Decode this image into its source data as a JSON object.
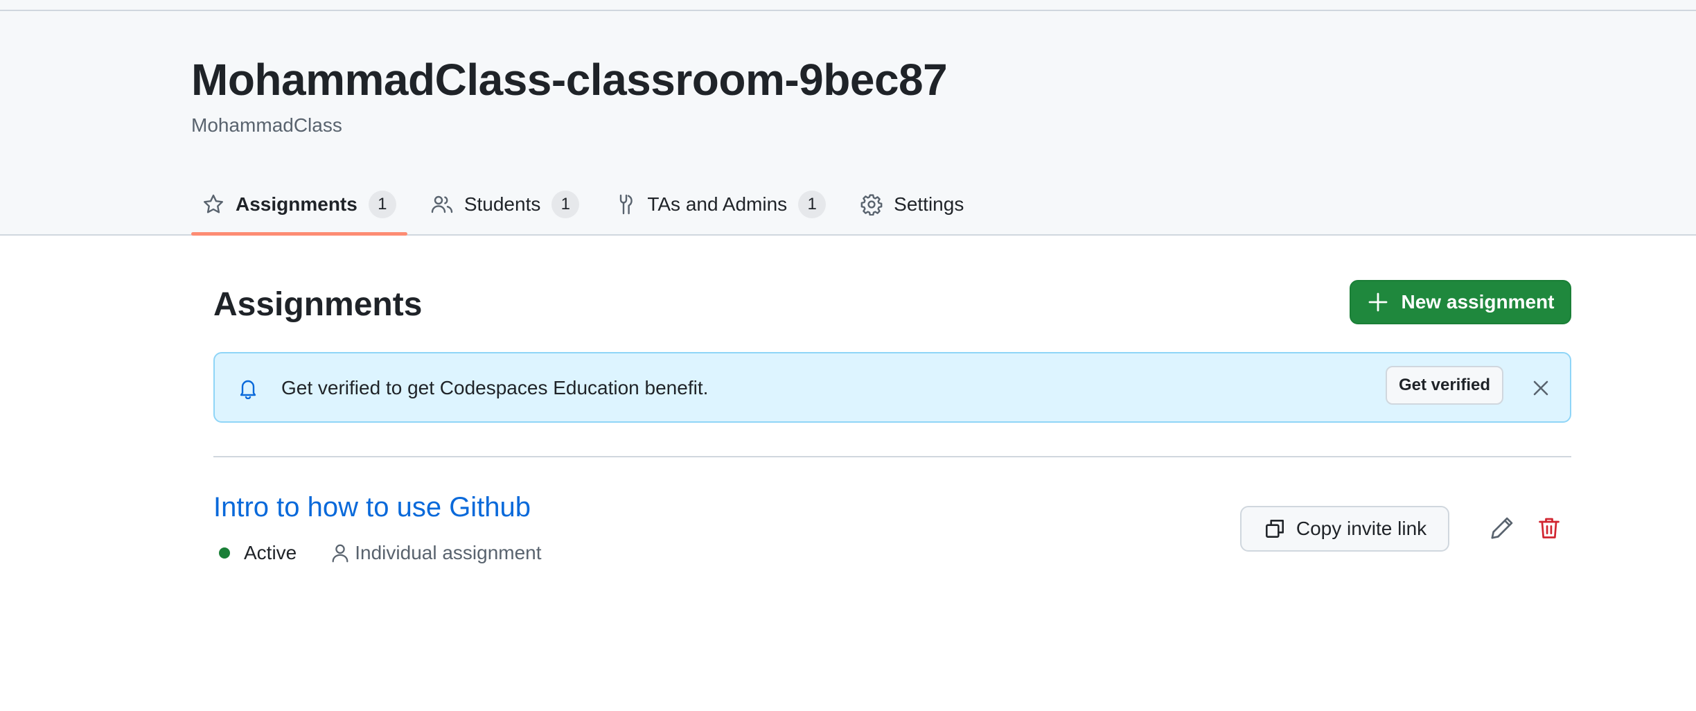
{
  "header": {
    "title": "MohammadClass-classroom-9bec87",
    "subtitle": "MohammadClass"
  },
  "tabs": [
    {
      "label": "Assignments",
      "count": "1",
      "icon": "star-icon",
      "active": true
    },
    {
      "label": "Students",
      "count": "1",
      "icon": "people-icon",
      "active": false
    },
    {
      "label": "TAs and Admins",
      "count": "1",
      "icon": "tools-icon",
      "active": false
    },
    {
      "label": "Settings",
      "icon": "gear-icon",
      "active": false
    }
  ],
  "main": {
    "title": "Assignments",
    "new_button_label": "New assignment"
  },
  "flash": {
    "message": "Get verified to get Codespaces Education benefit.",
    "button_label": "Get verified"
  },
  "assignment": {
    "title": "Intro to how to use Github",
    "status": "Active",
    "type": "Individual assignment",
    "copy_label": "Copy invite link"
  },
  "colors": {
    "accent_green": "#1f883d",
    "link_blue": "#0969da",
    "tab_underline": "#fd8c73",
    "danger_red": "#d1242f",
    "flash_bg": "#ddf4ff"
  }
}
